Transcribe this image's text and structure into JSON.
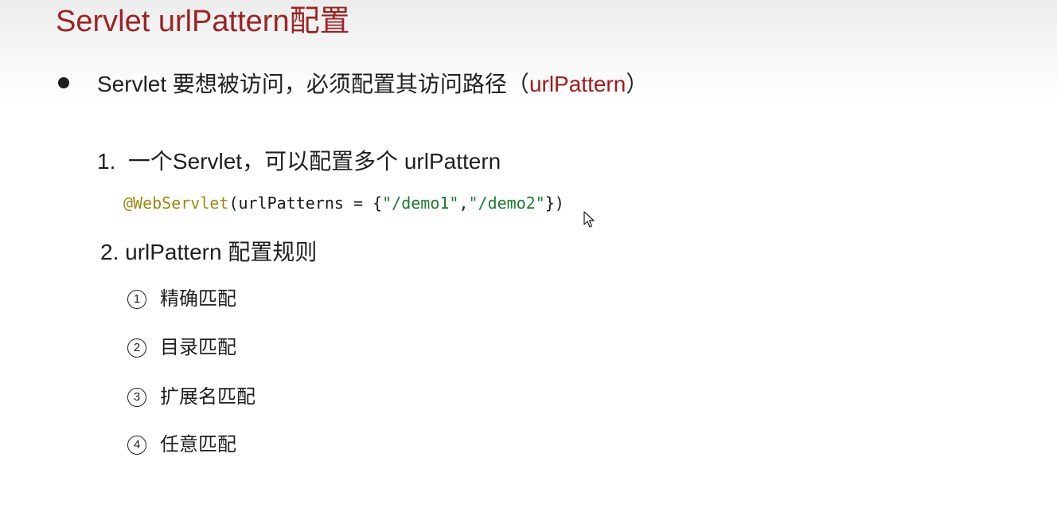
{
  "slide": {
    "title": "Servlet urlPattern配置",
    "bullet": {
      "text_before": "Servlet 要想被访问，必须配置其访问路径（",
      "highlight": "urlPattern",
      "text_after": "）"
    },
    "item1": {
      "number": "1.",
      "text": "一个Servlet，可以配置多个 urlPattern"
    },
    "code": {
      "annotation": "@WebServlet",
      "open": "(urlPatterns = {",
      "str1": "\"/demo1\"",
      "comma": ",",
      "str2": "\"/demo2\"",
      "close": "})"
    },
    "item2": {
      "number": "2.",
      "text": "urlPattern 配置规则"
    },
    "rules": [
      {
        "marker": "1",
        "label": "精确匹配"
      },
      {
        "marker": "2",
        "label": "目录匹配"
      },
      {
        "marker": "3",
        "label": "扩展名匹配"
      },
      {
        "marker": "4",
        "label": "任意匹配"
      }
    ],
    "colors": {
      "title": "#9b2424",
      "accent": "#a11b1b",
      "annotation": "#9d8a14",
      "string": "#1f7a31",
      "text": "#1f1f1f"
    },
    "icons": {
      "bullet": "filled-circle-bullet",
      "cursor": "mouse-pointer-icon"
    }
  }
}
